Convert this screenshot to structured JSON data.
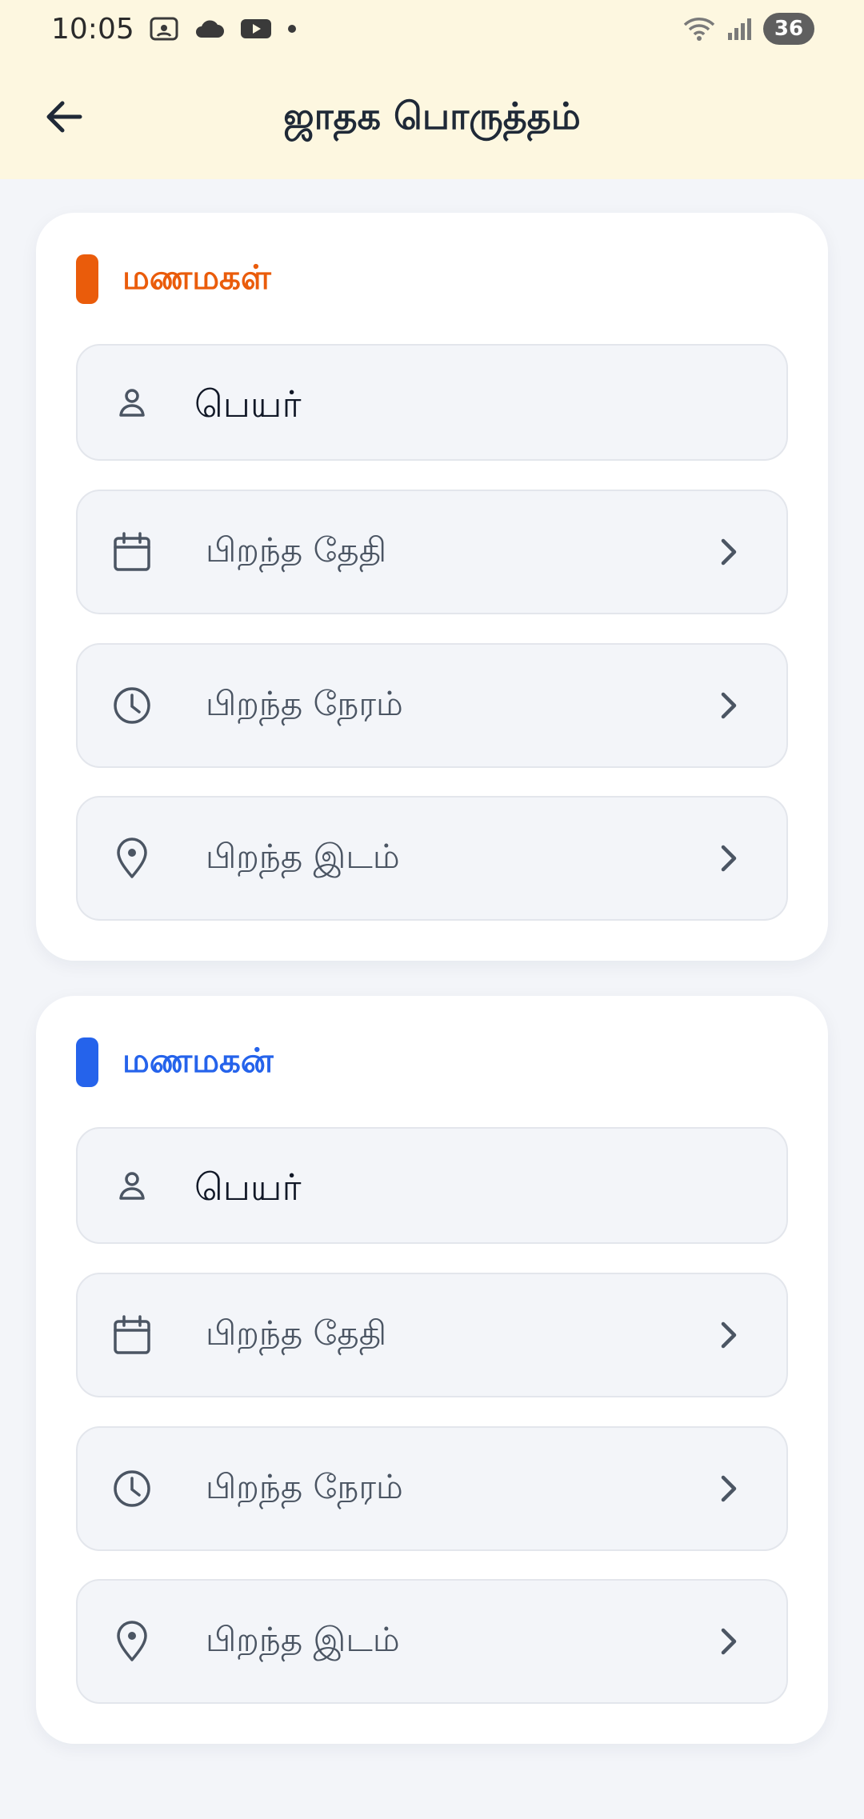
{
  "status_bar": {
    "time": "10:05",
    "battery": "36",
    "icons": [
      "screenshot-icon",
      "cloud-icon",
      "youtube-icon",
      "dot-icon",
      "wifi-icon",
      "signal-icon"
    ]
  },
  "app_bar": {
    "title": "ஜாதக பொருத்தம்",
    "back_icon": "arrow-left-icon"
  },
  "bride": {
    "title": "மணமகள்",
    "accent_color": "#ea5c0b",
    "name_placeholder": "பெயர்",
    "dob_label": "பிறந்த தேதி",
    "time_label": "பிறந்த நேரம்",
    "place_label": "பிறந்த இடம்"
  },
  "groom": {
    "title": "மணமகன்",
    "accent_color": "#2563eb",
    "name_placeholder": "பெயர்",
    "dob_label": "பிறந்த தேதி",
    "time_label": "பிறந்த நேரம்",
    "place_label": "பிறந்த இடம்"
  }
}
